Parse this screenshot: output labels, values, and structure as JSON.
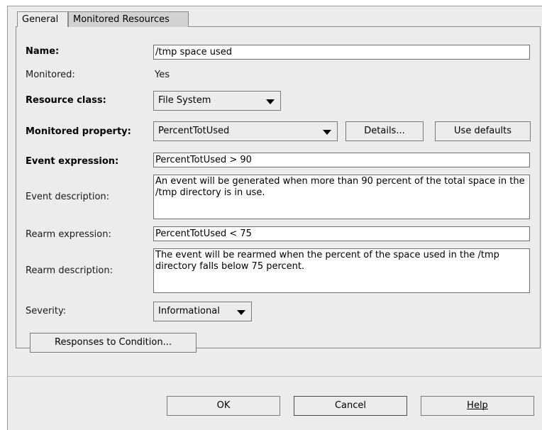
{
  "tabs": [
    {
      "label": "General"
    },
    {
      "label": "Monitored Resources"
    }
  ],
  "form": {
    "name_label": "Name:",
    "name_value": "/tmp space used",
    "monitored_label": "Monitored:",
    "monitored_value": "Yes",
    "resource_class_label": "Resource class:",
    "resource_class_value": "File System",
    "monitored_property_label": "Monitored property:",
    "monitored_property_value": "PercentTotUsed",
    "details_button": "Details...",
    "use_defaults_button": "Use defaults",
    "event_expression_label": "Event expression:",
    "event_expression_value": "PercentTotUsed > 90",
    "event_description_label": "Event description:",
    "event_description_value": "An event will be generated when more than 90 percent of the total space in the /tmp directory is in use.",
    "rearm_expression_label": "Rearm expression:",
    "rearm_expression_value": "PercentTotUsed < 75",
    "rearm_description_label": "Rearm description:",
    "rearm_description_value": "The event will be rearmed when the percent of the space used in the /tmp directory falls below 75 percent.",
    "severity_label": "Severity:",
    "severity_value": "Informational",
    "responses_button": "Responses to Condition..."
  },
  "footer": {
    "ok_button": "OK",
    "cancel_button": "Cancel",
    "help_button": "Help"
  },
  "icons": {
    "dropdown_arrow": "chevron-down-icon"
  }
}
